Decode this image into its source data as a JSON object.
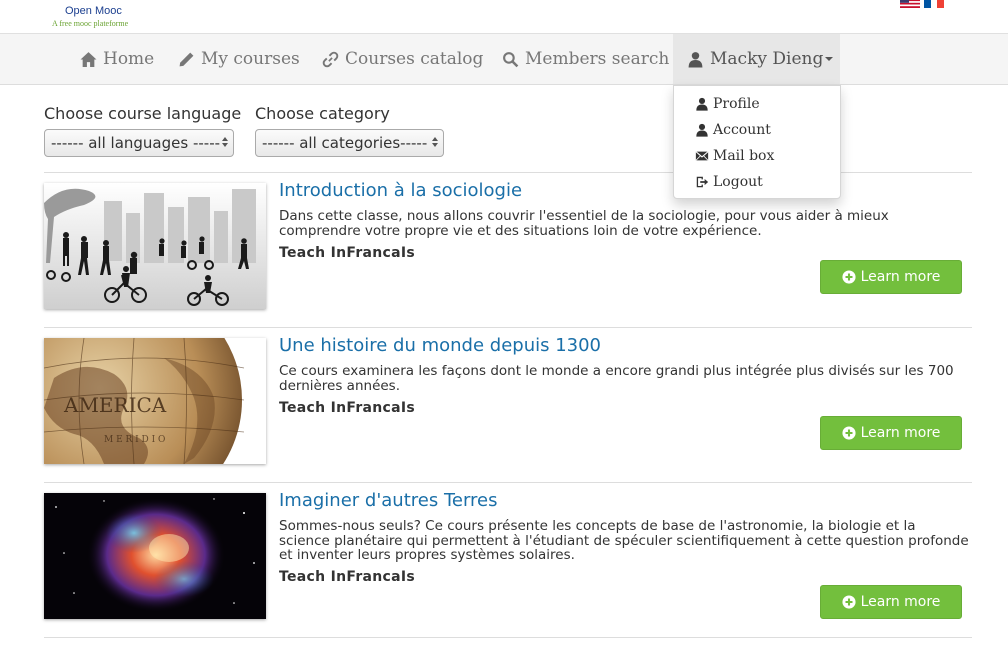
{
  "header": {
    "logo_title": "Open Mooc",
    "logo_subtitle": "A free mooc plateforme",
    "flags": [
      "us-flag-icon",
      "fr-flag-icon"
    ]
  },
  "nav": {
    "home": "Home",
    "my_courses": "My courses",
    "catalog": "Courses catalog",
    "members_search": "Members search",
    "user": "Macky Dieng"
  },
  "user_menu": {
    "items": [
      {
        "label": "Profile",
        "icon": "user-icon"
      },
      {
        "label": "Account",
        "icon": "user-icon"
      },
      {
        "label": "Mail box",
        "icon": "envelope-icon"
      },
      {
        "label": "Logout",
        "icon": "logout-icon"
      }
    ]
  },
  "filters": {
    "language_label": "Choose course language",
    "language_value": "------ all languages -----",
    "category_label": "Choose category",
    "category_value": "------ all categories-----"
  },
  "courses": [
    {
      "title": "Introduction à la sociologie",
      "description": "Dans cette classe, nous allons couvrir l'essentiel de la sociologie, pour vous aider à mieux comprendre votre propre vie et des situations loin de votre expérience.",
      "author": "Teach InFrancaIs",
      "button": "Learn more"
    },
    {
      "title": "Une histoire du monde depuis 1300",
      "description": "Ce cours examinera les façons dont le monde a encore grandi plus intégrée plus divisés sur les 700 dernières années.",
      "author": "Teach InFrancaIs",
      "button": "Learn more"
    },
    {
      "title": "Imaginer d'autres Terres",
      "description": "Sommes-nous seuls? Ce cours présente les concepts de base de l'astronomie, la biologie et la science planétaire qui permettent à l'étudiant de spéculer scientifiquement à cette question profonde et inventer leurs propres systèmes solaires.",
      "author": "Teach InFrancaIs",
      "button": "Learn more"
    }
  ],
  "colors": {
    "link": "#1a6fa8",
    "button": "#73bf3d",
    "navbar": "#f5f5f5"
  }
}
